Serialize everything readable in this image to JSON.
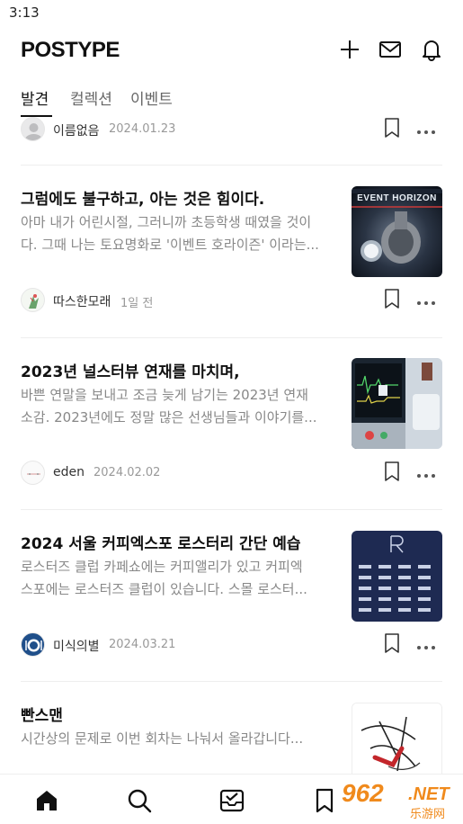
{
  "status_bar": {
    "time": "3:13"
  },
  "header": {
    "logo": "POSTYPE",
    "icons": [
      "plus-icon",
      "mail-icon",
      "bell-icon"
    ]
  },
  "tabs": [
    {
      "label": "발견",
      "active": true
    },
    {
      "label": "컬렉션",
      "active": false
    },
    {
      "label": "이벤트",
      "active": false
    }
  ],
  "feed": {
    "partial_meta": {
      "author": "이름없음",
      "date": "2024.01.23"
    },
    "posts": [
      {
        "title": "그럼에도 불구하고, 아는 것은 힘이다.",
        "excerpt_line1": "아마 내가 어린시절, 그러니까 초등학생 때였을 것이",
        "excerpt_line2": "다. 그때 나는 토요명화로 '이벤트 호라이즌' 이라는...",
        "thumb_text": "EVENT HORIZON",
        "author": "따스한모래",
        "date": "1일 전"
      },
      {
        "title": "2023년 널스터뷰 연재를 마치며,",
        "excerpt_line1": "바쁜 연말을 보내고 조금 늦게 남기는 2023년 연재",
        "excerpt_line2": "소감. 2023년에도 정말 많은 선생님들과 이야기를...",
        "author": "eden",
        "date": "2024.02.02"
      },
      {
        "title": "2024 서울 커피엑스포 로스터리 간단 예습",
        "excerpt_line1": "로스터즈 클럽 카페쇼에는 커피앨리가 있고 커피엑",
        "excerpt_line2": "스포에는 로스터즈 클럽이 있습니다. 스몰 로스터...",
        "author": "미식의별",
        "date": "2024.03.21"
      },
      {
        "title": "빤스맨",
        "excerpt_line1": "시간상의 문제로 이번 회차는 나눠서 올라갑니다..."
      }
    ]
  },
  "bottom_nav": [
    "home-icon",
    "search-icon",
    "inbox-check-icon",
    "bookmark-icon"
  ],
  "watermark": {
    "number": "962",
    "suffix": ".NET",
    "sub": "乐游网"
  },
  "colors": {
    "text": "#111111",
    "muted": "#888888",
    "divider": "#eeeeee",
    "watermark": "#f08a1c"
  }
}
